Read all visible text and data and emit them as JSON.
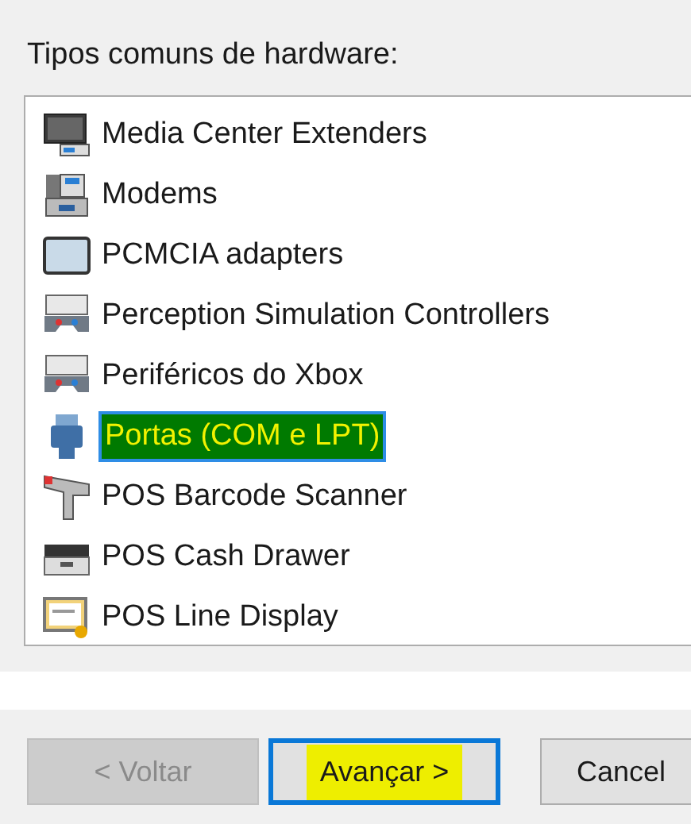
{
  "label": "Tipos comuns de hardware:",
  "items": [
    {
      "label": "Media Center Extenders",
      "kind": "monitor",
      "selected": false
    },
    {
      "label": "Modems",
      "kind": "modem",
      "selected": false
    },
    {
      "label": "PCMCIA adapters",
      "kind": "card",
      "selected": false
    },
    {
      "label": "Perception Simulation Controllers",
      "kind": "gamepad",
      "selected": false
    },
    {
      "label": "Periféricos do Xbox",
      "kind": "gamepad",
      "selected": false
    },
    {
      "label": "Portas (COM e LPT)",
      "kind": "port",
      "selected": true
    },
    {
      "label": "POS Barcode Scanner",
      "kind": "scanner",
      "selected": false
    },
    {
      "label": "POS Cash Drawer",
      "kind": "drawer",
      "selected": false
    },
    {
      "label": "POS Line Display",
      "kind": "display",
      "selected": false
    }
  ],
  "buttons": [
    {
      "label": "< Voltar",
      "disabled": true,
      "default": false,
      "highlighted": false
    },
    {
      "label": "Avançar >",
      "disabled": false,
      "default": true,
      "highlighted": true
    },
    {
      "label": "Cancel",
      "disabled": false,
      "default": false,
      "highlighted": false
    }
  ]
}
